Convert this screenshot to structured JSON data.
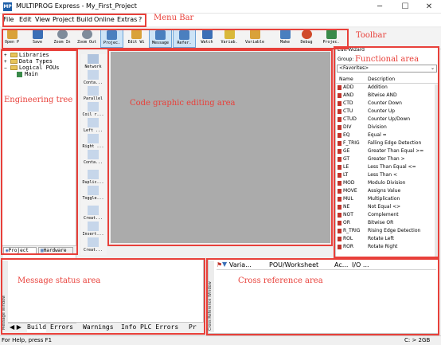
{
  "window": {
    "title": "MULTIPROG Express - My_First_Project",
    "app_icon_text": "MP",
    "minimize": "─",
    "maximize": "☐",
    "close": "✕"
  },
  "menu": [
    "File",
    "Edit",
    "View",
    "Project",
    "Build",
    "Online",
    "Extras",
    "?"
  ],
  "toolbar": [
    {
      "label": "Open P",
      "icon": "open-icon",
      "color": "#d9a23a"
    },
    {
      "label": "Save",
      "icon": "save-icon",
      "color": "#3b6fb6"
    },
    {
      "label": "Zoom In",
      "icon": "zoom-in-icon",
      "color": "#7f8c9b"
    },
    {
      "label": "Zoom Out",
      "icon": "zoom-out-icon",
      "color": "#7f8c9b"
    },
    {
      "label": "Projec.",
      "icon": "project-icon",
      "color": "#4a7fbf"
    },
    {
      "label": "Edit Wi",
      "icon": "edit-window-icon",
      "color": "#d9a23a"
    },
    {
      "label": "Message",
      "icon": "message-icon",
      "color": "#4a7fbf"
    },
    {
      "label": "Refer.",
      "icon": "reference-icon",
      "color": "#4a7fbf"
    },
    {
      "label": "Watch",
      "icon": "watch-icon",
      "color": "#3b6fb6"
    },
    {
      "label": "Variab.",
      "icon": "variables-icon",
      "color": "#d9b83a"
    },
    {
      "label": "Variable",
      "icon": "variable-icon",
      "color": "#d9a23a"
    },
    {
      "label": "Make",
      "icon": "make-icon",
      "color": "#4a7fbf"
    },
    {
      "label": "Debug",
      "icon": "debug-icon",
      "color": "#d04a2a"
    },
    {
      "label": "Projec.",
      "icon": "project-control-icon",
      "color": "#3a8a4a"
    }
  ],
  "tree": {
    "items": [
      {
        "label": "Libraries",
        "indent": 0
      },
      {
        "label": "Data Types",
        "indent": 0
      },
      {
        "label": "Logical POUs",
        "indent": 0
      },
      {
        "label": "Main",
        "indent": 1
      }
    ],
    "tabs": [
      "Project",
      "Hardware"
    ]
  },
  "palette": [
    "Network",
    "Conta...",
    "Parallel",
    "Coil r...",
    "Left ...",
    "Right ...",
    "Conta...",
    "Duplic...",
    "Toggle...",
    "Creat...",
    "Insert...",
    "Creat..."
  ],
  "functional": {
    "title": "Edit Wizard",
    "group_label": "Group:",
    "group_value": "<Favorites>",
    "col_name": "Name",
    "col_desc": "Description",
    "rows": [
      {
        "name": "ADD",
        "desc": "Addition"
      },
      {
        "name": "AND",
        "desc": "Bitwise AND"
      },
      {
        "name": "CTD",
        "desc": "Counter Down"
      },
      {
        "name": "CTU",
        "desc": "Counter Up"
      },
      {
        "name": "CTUD",
        "desc": "Counter Up/Down"
      },
      {
        "name": "DIV",
        "desc": "Division"
      },
      {
        "name": "EQ",
        "desc": "Equal ="
      },
      {
        "name": "F_TRIG",
        "desc": "Falling Edge Detection"
      },
      {
        "name": "GE",
        "desc": "Greater Than Equal >="
      },
      {
        "name": "GT",
        "desc": "Greater Than >"
      },
      {
        "name": "LE",
        "desc": "Less Than Equal <="
      },
      {
        "name": "LT",
        "desc": "Less Than <"
      },
      {
        "name": "MOD",
        "desc": "Modulo Division"
      },
      {
        "name": "MOVE",
        "desc": "Assigns Value"
      },
      {
        "name": "MUL",
        "desc": "Multiplication"
      },
      {
        "name": "NE",
        "desc": "Not Equal <>"
      },
      {
        "name": "NOT",
        "desc": "Complement"
      },
      {
        "name": "OR",
        "desc": "Bitwise OR"
      },
      {
        "name": "R_TRIG",
        "desc": "Rising Edge Detection"
      },
      {
        "name": "ROL",
        "desc": "Rotate Left"
      },
      {
        "name": "ROR",
        "desc": "Rotate Right"
      }
    ]
  },
  "message": {
    "side_label": "Message Window",
    "tabs": [
      "Build",
      "Errors",
      "Warnings",
      "Info",
      "PLC Errors",
      "Pr"
    ]
  },
  "crossref": {
    "side_label": "Cross Reference Window",
    "cols": [
      "Varia...",
      "POU/Worksheet",
      "Ac...",
      "I/O ..."
    ]
  },
  "status": {
    "left": "For Help, press F1",
    "right": "C: > 2GB"
  },
  "annotations": {
    "menu_bar": "Menu Bar",
    "toolbar": "Toolbar",
    "functional": "Functional area",
    "engineering_tree": "Engineering tree",
    "code_area": "Code graphic editing area",
    "message_status": "Message status area",
    "cross_reference": "Cross reference area"
  },
  "colors": {
    "annotation_red": "#e8403a",
    "editor_gray": "#ababab",
    "function_icon_red": "#c0342b"
  }
}
